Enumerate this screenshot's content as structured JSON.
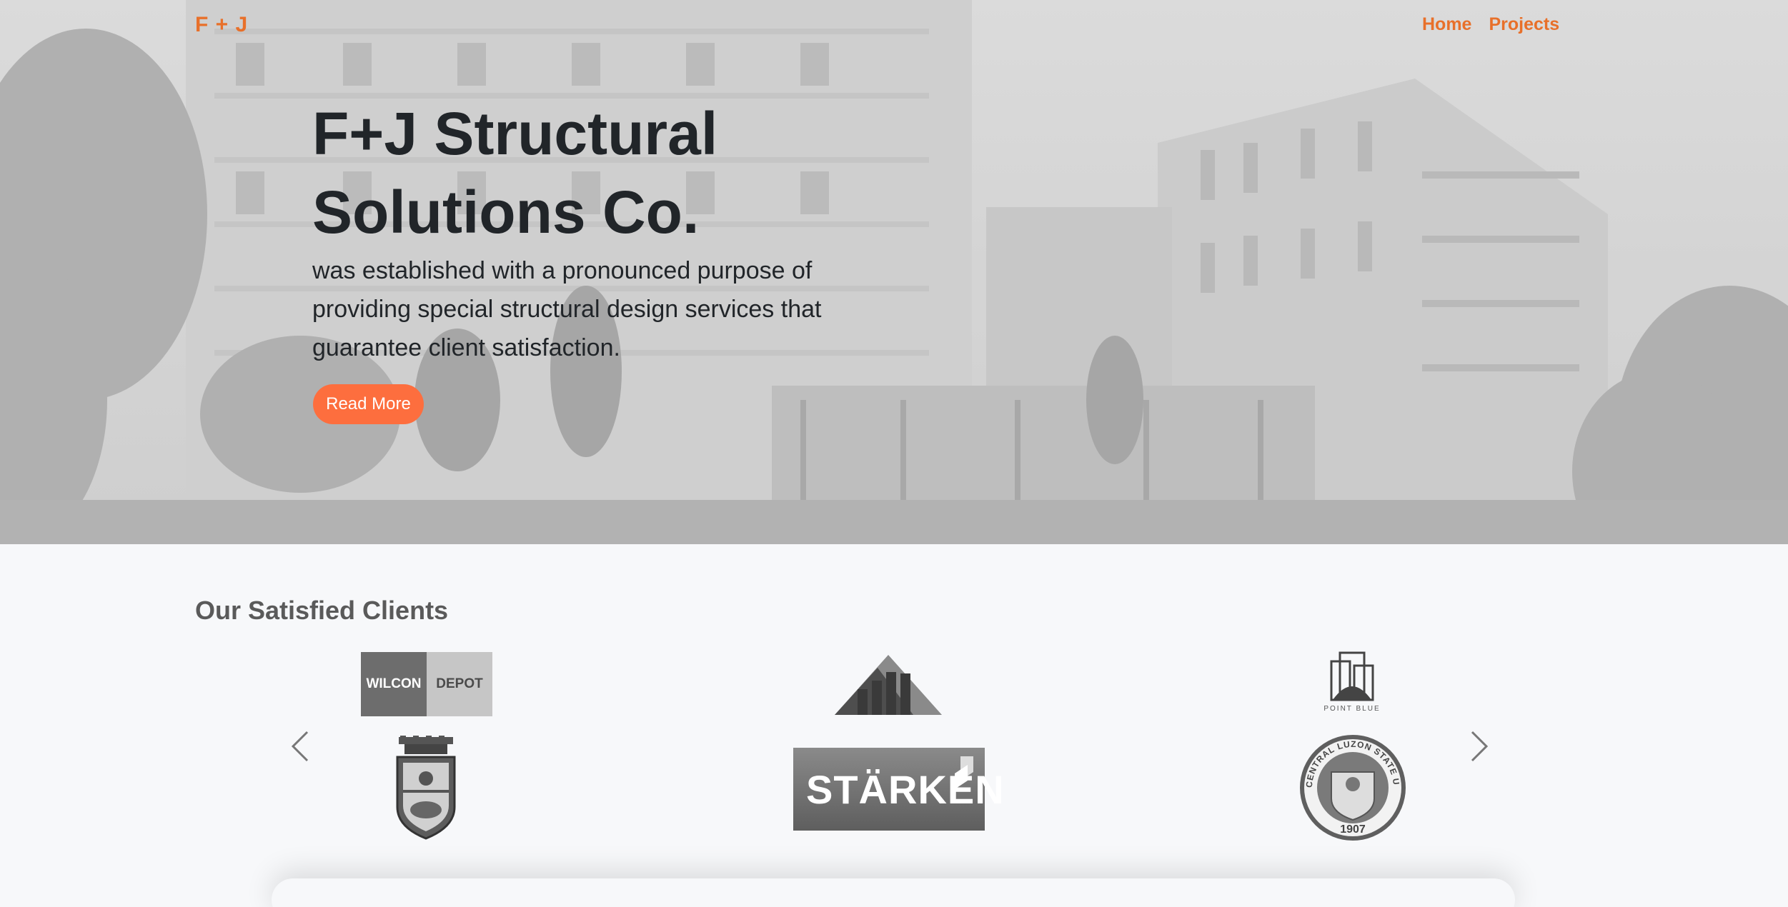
{
  "brand": {
    "name": "F + J"
  },
  "nav": {
    "items": [
      "Home",
      "Projects"
    ]
  },
  "hero": {
    "title_line1": "F+J Structural",
    "title_line2": "Solutions Co.",
    "subtitle_line1": "was established with a pronounced purpose of",
    "subtitle_line2": "providing special structural design services that",
    "subtitle_line3": "guarantee client satisfaction.",
    "cta_label": "Read More"
  },
  "clients": {
    "title": "Our Satisfied Clients",
    "logos": {
      "wilcon_left": "WILCON",
      "wilcon_right": "DEPOT",
      "starken": "STÄRKEN",
      "point_blue": "POINT BLUE",
      "clsu_ring": "CENTRAL LUZON STATE UNIVERSITY",
      "clsu_year": "1907"
    }
  },
  "colors": {
    "accent": "#e8702a",
    "button": "#fd6e3e",
    "page_bg": "#f7f8fa"
  }
}
